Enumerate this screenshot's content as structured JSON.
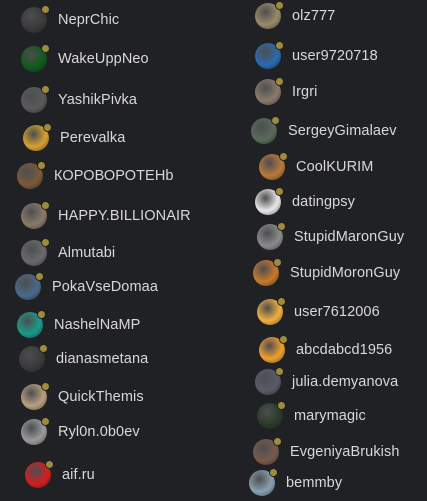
{
  "status_dot_color": "#a08a3c",
  "left_column": [
    {
      "name": "NeprChic",
      "avatar": "dark-cat-avatar",
      "color": "#3a3a3a"
    },
    {
      "name": "WakeUppNeo",
      "avatar": "matrix-code-avatar",
      "color": "#0f5a1a"
    },
    {
      "name": "YashikPivka",
      "avatar": "person-photo-avatar",
      "color": "#5a5a5a"
    },
    {
      "name": "Perevalka",
      "avatar": "cartoon-avatar",
      "color": "#d8a030"
    },
    {
      "name": "КОРОВОРОТЕНb",
      "avatar": "person-photo-avatar",
      "color": "#7a5a3a"
    },
    {
      "name": "HAPPY.BILLIONAIR",
      "avatar": "person-photo-avatar",
      "color": "#8a7a6a"
    },
    {
      "name": "Almutabi",
      "avatar": "person-photo-avatar",
      "color": "#6a6a6a"
    },
    {
      "name": "PokaVseDomaa",
      "avatar": "person-photo-avatar",
      "color": "#4a6a8a"
    },
    {
      "name": "NashelNaMP",
      "avatar": "teal-icon-avatar",
      "color": "#1a9a8a"
    },
    {
      "name": "dianasmetana",
      "avatar": "sketch-avatar",
      "color": "#3a3a3a"
    },
    {
      "name": "QuickThemis",
      "avatar": "person-photo-avatar",
      "color": "#b8a080"
    },
    {
      "name": "Ryl0n.0b0ev",
      "avatar": "person-photo-avatar",
      "color": "#9a9a9a"
    },
    {
      "name": "aif.ru",
      "avatar": "aif-logo-avatar",
      "color": "#d02020"
    }
  ],
  "right_column": [
    {
      "name": "olz777",
      "avatar": "landscape-avatar",
      "color": "#9a8a6a"
    },
    {
      "name": "user9720718",
      "avatar": "globe-avatar",
      "color": "#2a6ab0"
    },
    {
      "name": "Irgri",
      "avatar": "person-photo-avatar",
      "color": "#8a7a6a"
    },
    {
      "name": "SergeyGimalaev",
      "avatar": "robot-avatar",
      "color": "#5a6a5a"
    },
    {
      "name": "CoolKURIM",
      "avatar": "cartoon-avatar",
      "color": "#b87a3a"
    },
    {
      "name": "datingpsy",
      "avatar": "person-photo-avatar",
      "color": "#e8e8e8"
    },
    {
      "name": "StupidMaronGuy",
      "avatar": "sketch-avatar",
      "color": "#8a8a8a"
    },
    {
      "name": "StupidMoronGuy",
      "avatar": "orange-avatar",
      "color": "#c8782a"
    },
    {
      "name": "user7612006",
      "avatar": "emoji-face-avatar",
      "color": "#f0b040"
    },
    {
      "name": "abcdabcd1956",
      "avatar": "emoji-face-avatar",
      "color": "#f0a030"
    },
    {
      "name": "julia.demyanova",
      "avatar": "person-photo-avatar",
      "color": "#5a5a6a"
    },
    {
      "name": "marymagic",
      "avatar": "dark-nature-avatar",
      "color": "#2a3a2a"
    },
    {
      "name": "EvgeniyaBrukish",
      "avatar": "person-photo-avatar",
      "color": "#7a5a4a"
    },
    {
      "name": "bemmby",
      "avatar": "landscape-avatar",
      "color": "#8aa0b0"
    }
  ]
}
